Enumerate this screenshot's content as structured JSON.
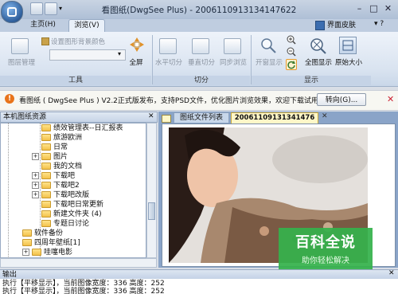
{
  "window": {
    "title": "看图纸(DwgSee Plus) - 20061109131341476​22"
  },
  "tabs": [
    {
      "label": "主页(H)"
    },
    {
      "label": "浏览(V)"
    }
  ],
  "skin_label": "界面皮肤",
  "ribbon": {
    "groups": {
      "tools": "工具",
      "split": "切分",
      "display": "显示"
    },
    "buttons": {
      "layer_mgmt": "图层管理",
      "set_bg": "设置图形背景颜色",
      "fullscreen": "全屏",
      "h_split": "水平切分",
      "v_split": "垂直切分",
      "sync_browse": "同步浏览",
      "open_window": "开窗显示",
      "fit_all": "全图显示",
      "original": "原始大小"
    }
  },
  "notice": {
    "text": "看图纸 ( DwgSee Plus ) V2.2正式版发布，支持PSD文件，优化图片浏览效果，欢迎下载试用!",
    "button": "转向(G)..."
  },
  "left_pane": {
    "title": "本机图纸资源",
    "tree": [
      {
        "label": "绩效管理表--日汇报表",
        "expand": ""
      },
      {
        "label": "旅游欧洲",
        "expand": ""
      },
      {
        "label": "日常",
        "expand": ""
      },
      {
        "label": "图片",
        "expand": "+"
      },
      {
        "label": "我的文档",
        "expand": ""
      },
      {
        "label": "下载吧",
        "expand": "+"
      },
      {
        "label": "下载吧2",
        "expand": "+"
      },
      {
        "label": "下载吧改版",
        "expand": "+"
      },
      {
        "label": "下载吧日常更新",
        "expand": ""
      },
      {
        "label": "新建文件夹 (4)",
        "expand": ""
      },
      {
        "label": "专题日讨论",
        "expand": ""
      },
      {
        "label": "软件备份",
        "expand": ""
      },
      {
        "label": "四周年壁纸[1]",
        "expand": ""
      },
      {
        "label": "哇噻电影",
        "expand": "+"
      }
    ]
  },
  "right_pane": {
    "tab_list": "图纸文件列表",
    "tab_file": "20061109131341476​22"
  },
  "watermark": {
    "title": "百科全说",
    "subtitle": "助你轻松解决"
  },
  "output": {
    "title": "输出",
    "lines": [
      "执行【平移显示】，当前图像宽度：336 高度：252",
      "执行【平移显示】，当前图像宽度：336 高度：252"
    ]
  }
}
